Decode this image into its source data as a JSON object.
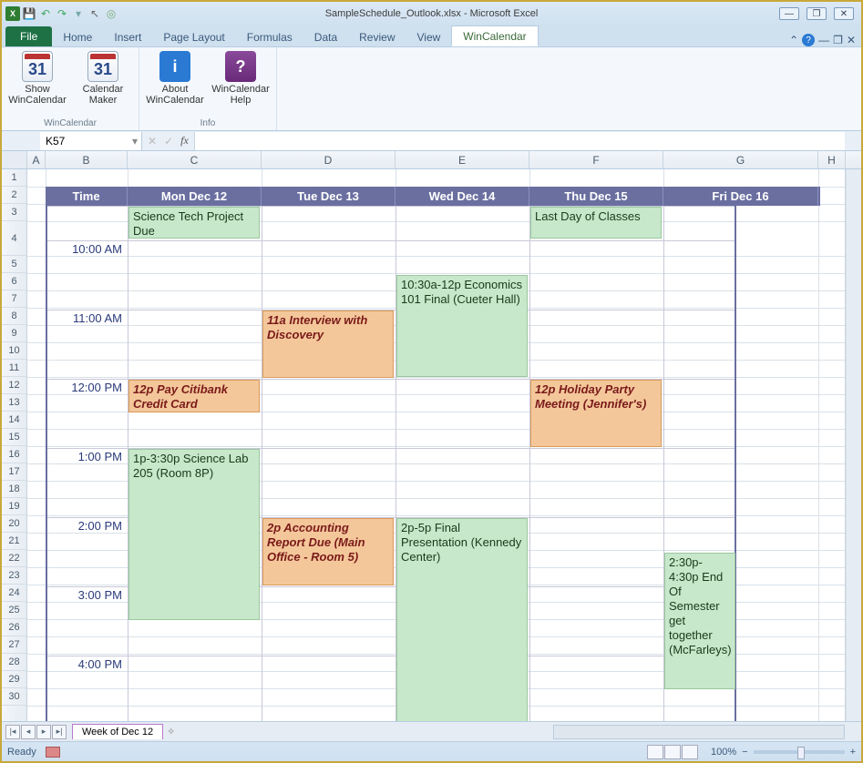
{
  "window": {
    "title": "SampleSchedule_Outlook.xlsx - Microsoft Excel"
  },
  "qat": {
    "save": "💾",
    "undo": "↶",
    "redo": "↷"
  },
  "tabs": {
    "file": "File",
    "home": "Home",
    "insert": "Insert",
    "page_layout": "Page Layout",
    "formulas": "Formulas",
    "data": "Data",
    "review": "Review",
    "view": "View",
    "wincal": "WinCalendar"
  },
  "ribbon": {
    "group1": {
      "label": "WinCalendar",
      "btn1_line1": "Show",
      "btn1_line2": "WinCalendar",
      "btn1_icon": "31",
      "btn2_line1": "Calendar",
      "btn2_line2": "Maker",
      "btn2_icon": "31"
    },
    "group2": {
      "label": "Info",
      "btn1_line1": "About",
      "btn1_line2": "WinCalendar",
      "btn1_icon": "i",
      "btn2_line1": "WinCalendar",
      "btn2_line2": "Help",
      "btn2_icon": "?"
    }
  },
  "namebox": "K57",
  "fx_label": "fx",
  "columns": [
    "A",
    "B",
    "C",
    "D",
    "E",
    "F",
    "G",
    "H"
  ],
  "rows": [
    "1",
    "2",
    "3",
    "4",
    "5",
    "6",
    "7",
    "8",
    "9",
    "10",
    "11",
    "12",
    "13",
    "14",
    "15",
    "16",
    "17",
    "18",
    "19",
    "20",
    "21",
    "22",
    "23",
    "24",
    "25",
    "26",
    "27",
    "28",
    "29",
    "30"
  ],
  "calendar": {
    "headers": {
      "time": "Time",
      "mon": "Mon Dec 12",
      "tue": "Tue Dec 13",
      "wed": "Wed Dec 14",
      "thu": "Thu Dec 15",
      "fri": "Fri Dec 16"
    },
    "times": {
      "t10": "10:00 AM",
      "t11": "11:00 AM",
      "t12": "12:00 PM",
      "t1": "1:00 PM",
      "t2": "2:00 PM",
      "t3": "3:00 PM",
      "t4": "4:00 PM"
    }
  },
  "events": {
    "sci_project": "Science Tech Project Due",
    "last_day": "Last Day of Classes",
    "econ_final": "10:30a-12p Economics 101 Final (Cueter Hall)",
    "interview": "11a Interview with Discovery",
    "citibank": "12p Pay Citibank Credit Card",
    "holiday": "12p Holiday Party Meeting (Jennifer's)",
    "sci_lab": "1p-3:30p Science Lab 205 (Room 8P)",
    "acct_report": "2p Accounting Report Due (Main Office - Room 5)",
    "final_pres": "2p-5p Final Presentation (Kennedy Center)",
    "semester_end": "2:30p-4:30p End Of Semester get together (McFarleys)"
  },
  "sheet_tab": "Week of Dec 12",
  "status": {
    "ready": "Ready",
    "zoom": "100%"
  },
  "chart_data": {
    "type": "table",
    "title": "Week of Dec 12",
    "columns": [
      "Time",
      "Mon Dec 12",
      "Tue Dec 13",
      "Wed Dec 14",
      "Thu Dec 15",
      "Fri Dec 16"
    ],
    "events": [
      {
        "day": "Mon Dec 12",
        "row": "allday",
        "text": "Science Tech Project Due",
        "color": "green"
      },
      {
        "day": "Thu Dec 15",
        "row": "allday",
        "text": "Last Day of Classes",
        "color": "green"
      },
      {
        "day": "Wed Dec 14",
        "start": "10:30",
        "end": "12:00",
        "text": "10:30a-12p Economics 101 Final (Cueter Hall)",
        "color": "green"
      },
      {
        "day": "Tue Dec 13",
        "start": "11:00",
        "end": "12:00",
        "text": "11a Interview with Discovery",
        "color": "orange"
      },
      {
        "day": "Mon Dec 12",
        "start": "12:00",
        "end": "12:30",
        "text": "12p Pay Citibank Credit Card",
        "color": "orange"
      },
      {
        "day": "Thu Dec 15",
        "start": "12:00",
        "end": "13:00",
        "text": "12p Holiday Party Meeting (Jennifer's)",
        "color": "orange"
      },
      {
        "day": "Mon Dec 12",
        "start": "13:00",
        "end": "15:30",
        "text": "1p-3:30p Science Lab 205 (Room 8P)",
        "color": "green"
      },
      {
        "day": "Tue Dec 13",
        "start": "14:00",
        "end": "15:00",
        "text": "2p Accounting Report Due (Main Office - Room 5)",
        "color": "orange"
      },
      {
        "day": "Wed Dec 14",
        "start": "14:00",
        "end": "17:00",
        "text": "2p-5p Final Presentation (Kennedy Center)",
        "color": "green"
      },
      {
        "day": "Fri Dec 16",
        "start": "14:30",
        "end": "16:30",
        "text": "2:30p-4:30p End Of Semester get together (McFarleys)",
        "color": "green"
      }
    ]
  }
}
